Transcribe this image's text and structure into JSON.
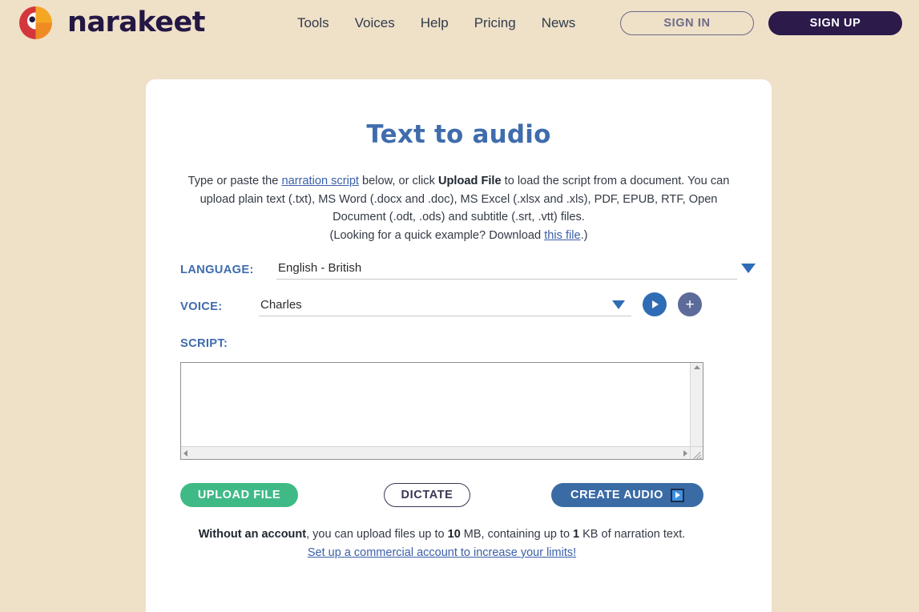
{
  "header": {
    "brand_name": "narakeet",
    "logo_icon": "parrot-logo-icon",
    "nav": [
      {
        "label": "Tools"
      },
      {
        "label": "Voices"
      },
      {
        "label": "Help"
      },
      {
        "label": "Pricing"
      },
      {
        "label": "News"
      }
    ],
    "sign_in_label": "SIGN IN",
    "sign_up_label": "SIGN UP"
  },
  "colors": {
    "page_background": "#efe0c8",
    "card_background": "#ffffff",
    "accent_blue": "#3f6cad",
    "brand_navy": "#2b1a4a",
    "green": "#3fba86",
    "logo_red": "#d3373c",
    "logo_yellow": "#f5a623",
    "logo_orange": "#ef8b22"
  },
  "main": {
    "title": "Text to audio",
    "intro": {
      "part1": "Type or paste the ",
      "link1": "narration script",
      "part2": " below, or click ",
      "bold1": "Upload File",
      "part3": " to load the script from a document. You can upload plain text (.txt), MS Word (.docx and .doc), MS Excel (.xlsx and .xls), PDF, EPUB, RTF, Open Document (.odt, .ods) and subtitle (.srt, .vtt) files.",
      "part4": "(Looking for a quick example? Download ",
      "link2": "this file",
      "part5": ".)"
    },
    "language": {
      "label": "LANGUAGE:",
      "value": "English - British",
      "caret_icon": "chevron-down-icon"
    },
    "voice": {
      "label": "VOICE:",
      "value": "Charles",
      "caret_icon": "chevron-down-icon",
      "preview_icon": "play-icon",
      "add_icon": "plus-icon"
    },
    "script": {
      "label": "SCRIPT:",
      "value": "",
      "placeholder": ""
    },
    "actions": {
      "upload_label": "UPLOAD FILE",
      "dictate_label": "DICTATE",
      "create_label": "CREATE AUDIO",
      "create_icon": "play-icon"
    },
    "limits": {
      "bold1": "Without an account",
      "part1": ", you can upload files up to ",
      "bold2": "10",
      "part2": " MB, containing up to ",
      "bold3": "1",
      "part3": " KB of narration text.",
      "link": "Set up a commercial account to increase your limits!"
    }
  }
}
